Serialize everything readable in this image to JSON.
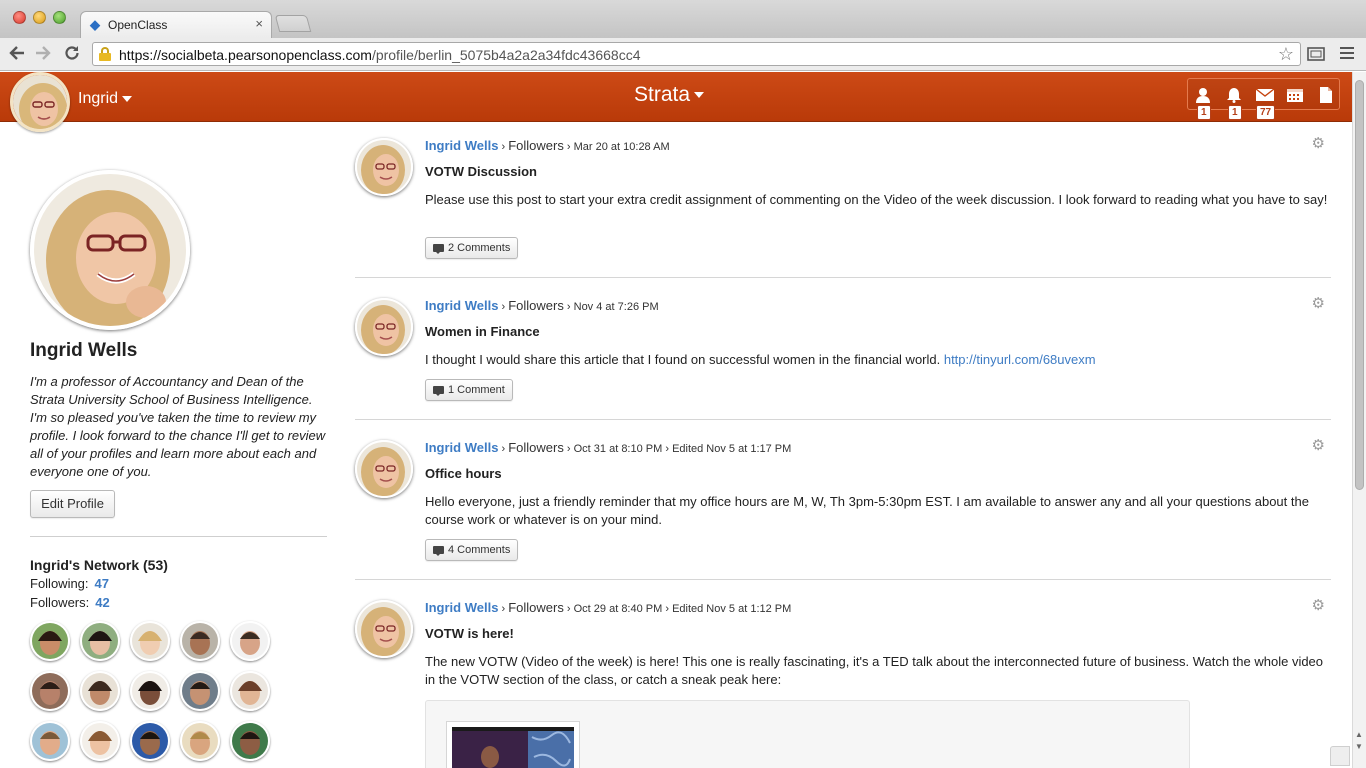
{
  "browser": {
    "tab_title": "OpenClass",
    "tab_close": "×",
    "url_host": "https://socialbeta.pearsonopenclass.com",
    "url_path": "/profile/berlin_5075b4a2a2a34fdc43668cc4"
  },
  "header": {
    "user_name": "Ingrid",
    "course_name": "Strata",
    "badges": {
      "requests": "1",
      "notifications": "1",
      "messages": "77"
    }
  },
  "profile": {
    "name": "Ingrid Wells",
    "bio": "I'm a professor of Accountancy and Dean of the Strata University School of Business Intelligence. I'm so pleased you've taken the time to review my profile. I look forward to the chance I'll get to review all of your profiles and learn more about each and everyone one of you.",
    "edit_label": "Edit Profile",
    "network_title": "Ingrid's Network (53)",
    "following_label": "Following:",
    "following_count": "47",
    "followers_label": "Followers:",
    "followers_count": "42"
  },
  "posts": [
    {
      "author": "Ingrid Wells",
      "group": "Followers",
      "timestamp": "Mar 20 at 10:28 AM",
      "edited": "",
      "title": "VOTW Discussion",
      "body": "Please use this post to start your extra credit assignment of commenting on the Video of the week discussion. I look forward to reading what you have to say!",
      "link": "",
      "comments": "2 Comments"
    },
    {
      "author": "Ingrid Wells",
      "group": "Followers",
      "timestamp": "Nov 4 at 7:26 PM",
      "edited": "",
      "title": "Women in Finance",
      "body": "I thought I would share this article that I found on successful women in the financial world. ",
      "link": "http://tinyurl.com/68uvexm",
      "comments": "1 Comment"
    },
    {
      "author": "Ingrid Wells",
      "group": "Followers",
      "timestamp": "Oct 31 at 8:10 PM",
      "edited": "Edited Nov 5 at 1:17 PM",
      "title": "Office hours",
      "body": "Hello everyone, just a friendly reminder that my office hours are M, W, Th 3pm-5:30pm EST. I am available to answer any and all your questions about the course work or whatever is on your mind.",
      "link": "",
      "comments": "4 Comments"
    },
    {
      "author": "Ingrid Wells",
      "group": "Followers",
      "timestamp": "Oct 29 at 8:40 PM",
      "edited": "Edited Nov 5 at 1:12 PM",
      "title": "VOTW is here!",
      "body": "The new VOTW (Video of the week) is here! This one is really fascinating, it's a TED talk about the interconnected future of business. Watch the whole video in the VOTW section of the class, or catch a sneak peak here:",
      "link": "",
      "comments": ""
    }
  ],
  "colors": {
    "brand": "#c5430f",
    "link": "#3e7cc4"
  }
}
